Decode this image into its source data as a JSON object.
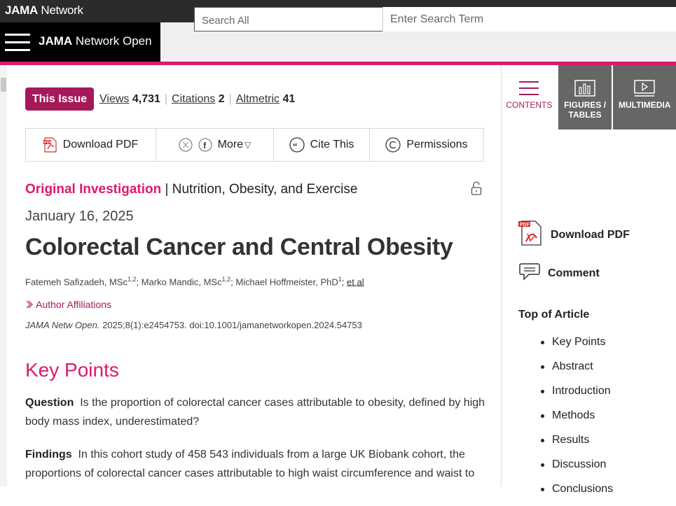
{
  "network": {
    "logo_bold": "JAMA",
    "logo_rest": " Network"
  },
  "header": {
    "journal_bold": "JAMA",
    "journal_rest": " Network Open",
    "search_all": "Search All",
    "search_placeholder": "Enter Search Term"
  },
  "article_meta": {
    "issue_button": "This Issue",
    "views_label": "Views",
    "views_value": "4,731",
    "citations_label": "Citations",
    "citations_value": "2",
    "altmetric_label": "Altmetric",
    "altmetric_value": "41"
  },
  "toolbar": {
    "download_pdf": "Download PDF",
    "more": "More",
    "cite_this": "Cite This",
    "permissions": "Permissions"
  },
  "article": {
    "type": "Original Investigation",
    "section": "Nutrition, Obesity, and Exercise",
    "date": "January 16, 2025",
    "title": "Colorectal Cancer and Central Obesity",
    "authors": [
      {
        "name": "Fatemeh Safizadeh, MSc",
        "sup": "1,2"
      },
      {
        "name": "Marko Mandic, MSc",
        "sup": "1,2"
      },
      {
        "name": "Michael Hoffmeister, PhD",
        "sup": "1"
      }
    ],
    "et_al": "et al",
    "author_affiliations": "Author Affiliations",
    "citation_journal": "JAMA Netw Open.",
    "citation_rest": " 2025;8(1):e2454753. doi:10.1001/jamanetworkopen.2024.54753"
  },
  "key_points": {
    "heading": "Key Points",
    "question_label": "Question",
    "question_text": "Is the proportion of colorectal cancer cases attributable to obesity, defined by high body mass index, underestimated?",
    "findings_label": "Findings",
    "findings_text": "In this cohort study of 458 543 individuals from a large UK Biobank cohort, the proportions of colorectal cancer cases attributable to high waist circumference and waist to"
  },
  "rail": {
    "tabs": [
      "CONTENTS",
      "FIGURES / TABLES",
      "MULTIMEDIA"
    ],
    "download_pdf": "Download PDF",
    "comment": "Comment",
    "top_of_article": "Top of Article",
    "toc": [
      "Key Points",
      "Abstract",
      "Introduction",
      "Methods",
      "Results",
      "Discussion",
      "Conclusions"
    ]
  },
  "colors": {
    "accent_pink": "#e0186c",
    "accent_plum": "#a5195b"
  }
}
